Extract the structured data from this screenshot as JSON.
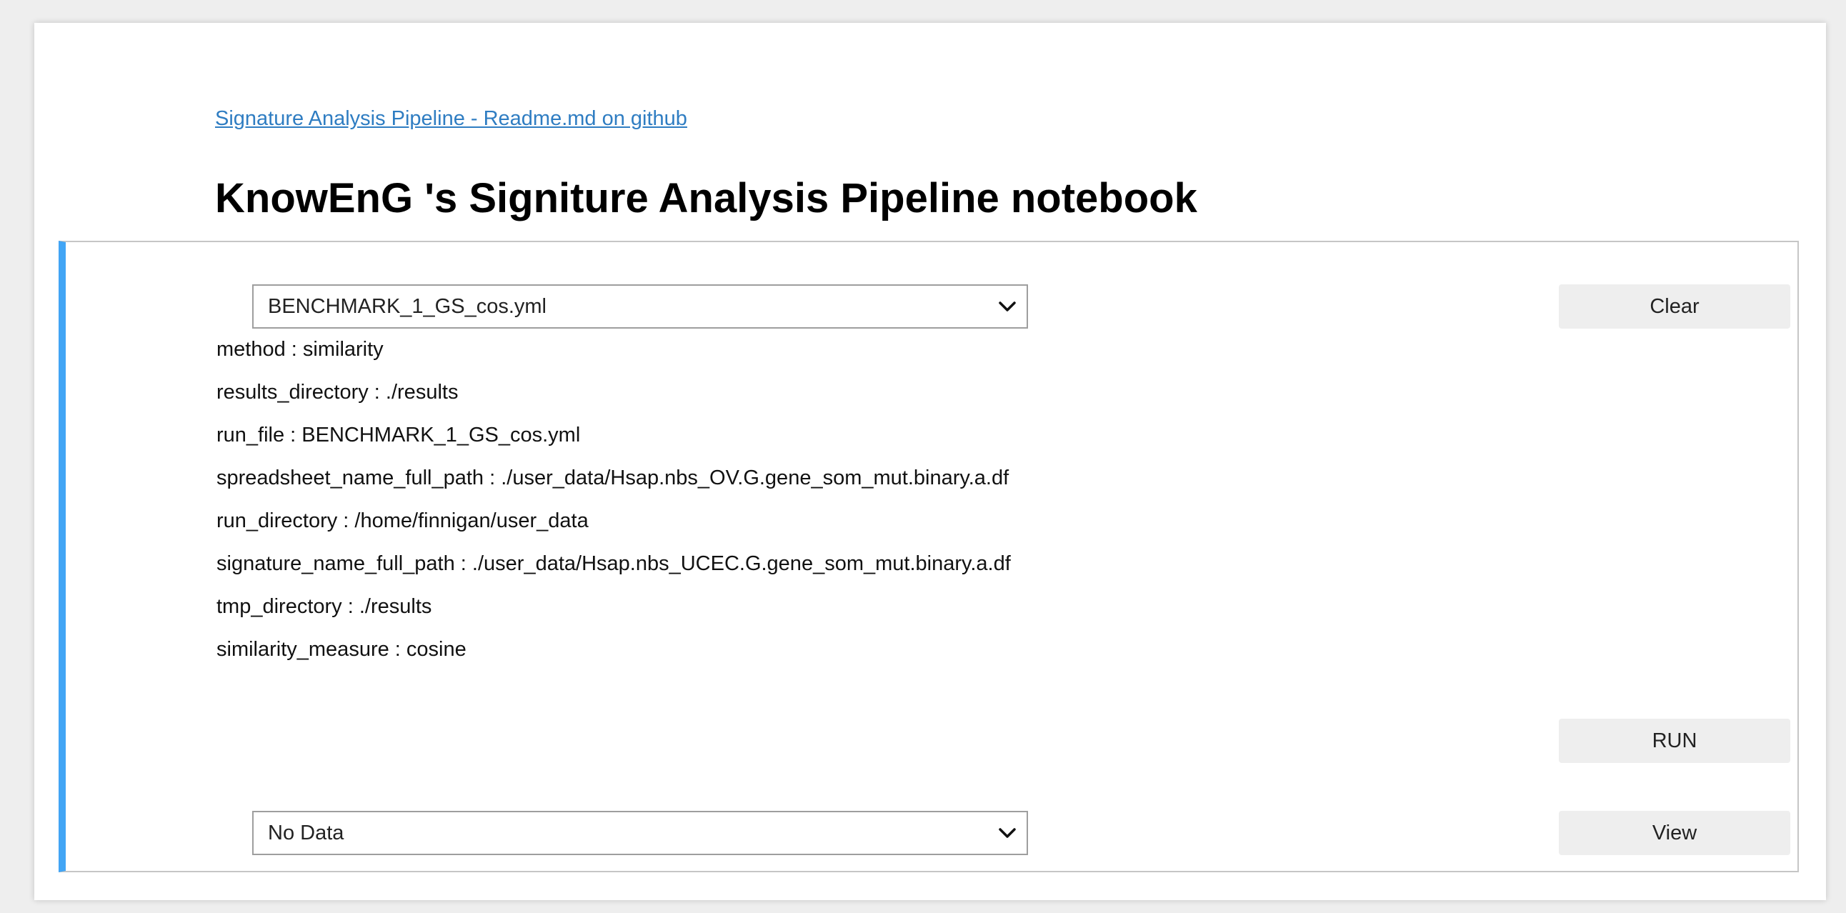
{
  "header": {
    "readme_link": "Signature Analysis Pipeline - Readme.md on github",
    "title": "KnowEnG 's Signiture Analysis Pipeline notebook"
  },
  "cell": {
    "run_file_select": {
      "selected": "BENCHMARK_1_GS_cos.yml"
    },
    "clear_label": "Clear",
    "parameters": [
      "method : similarity",
      "results_directory : ./results",
      "run_file : BENCHMARK_1_GS_cos.yml",
      "spreadsheet_name_full_path : ./user_data/Hsap.nbs_OV.G.gene_som_mut.binary.a.df",
      "run_directory : /home/finnigan/user_data",
      "signature_name_full_path : ./user_data/Hsap.nbs_UCEC.G.gene_som_mut.binary.a.df",
      "tmp_directory : ./results",
      "similarity_measure : cosine"
    ],
    "run_label": "RUN",
    "results_select": {
      "selected": "No Data"
    },
    "view_label": "View"
  },
  "icons": {
    "select_arrow": "chevron-down-icon"
  },
  "colors": {
    "link": "#2f7dc2",
    "cell_accent": "#42a5f5",
    "button_bg": "#eeeeee"
  }
}
